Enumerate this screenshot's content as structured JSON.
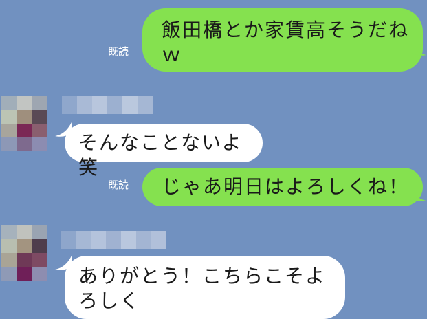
{
  "messages": [
    {
      "side": "sent",
      "status": "既読",
      "text": "飯田橋とか家賃高そうだね\nｗ"
    },
    {
      "side": "received",
      "text": "そんなことないよ笑"
    },
    {
      "side": "sent",
      "status": "既読",
      "text": "じゃあ明日はよろしくね！"
    },
    {
      "side": "received",
      "text": "ありがとう！こちらこそよ\nろしく"
    }
  ],
  "colors": {
    "background": "#7191c0",
    "sent_bubble": "#85e14f",
    "received_bubble": "#ffffff",
    "status_text": "#ffffff"
  }
}
